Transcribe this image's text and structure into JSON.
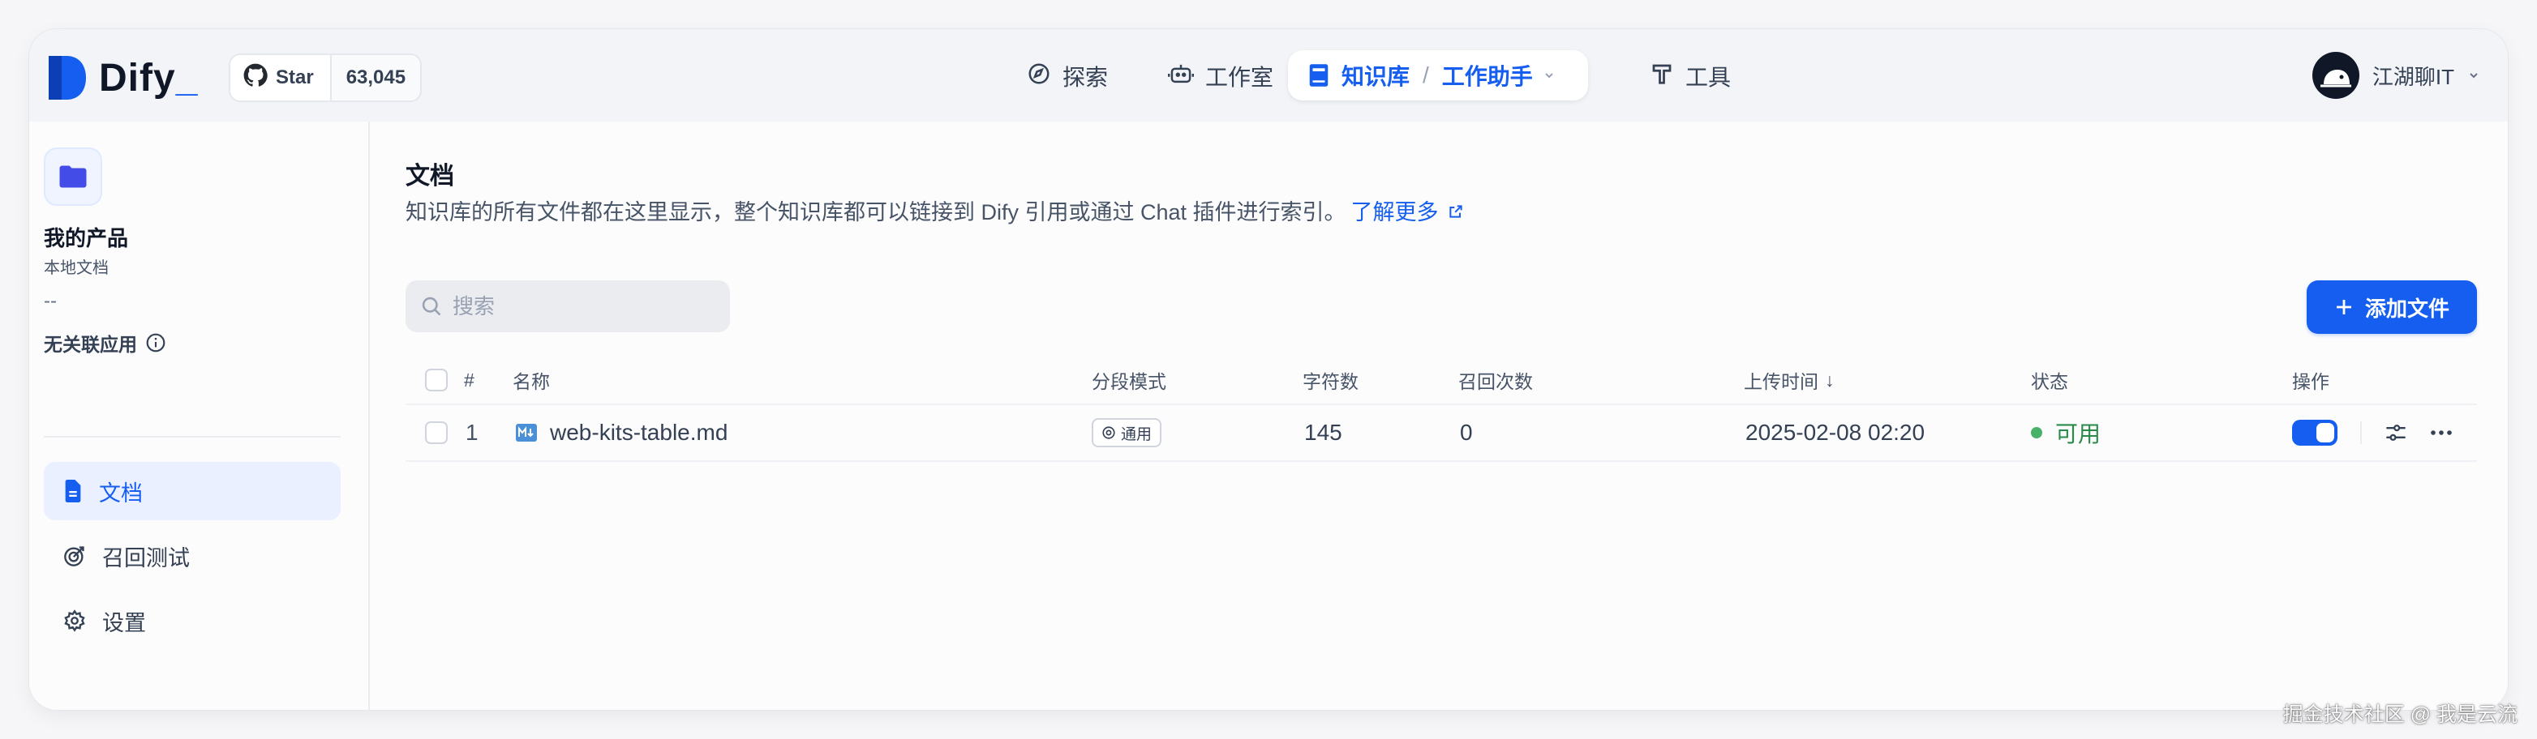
{
  "header": {
    "brand": "Dify",
    "github": {
      "star_label": "Star",
      "star_count": "63,045"
    },
    "nav": [
      {
        "label": "探索",
        "icon": "compass-icon"
      },
      {
        "label": "工作室",
        "icon": "robot-icon"
      },
      {
        "label": "工具",
        "icon": "hammer-icon"
      }
    ],
    "active_nav": {
      "label": "知识库",
      "separator": "/",
      "current": "工作助手",
      "icon": "book-icon"
    },
    "user": {
      "name": "江湖聊IT",
      "icon": "chevron-down-icon"
    }
  },
  "sidebar": {
    "dataset_name": "我的产品",
    "dataset_type": "本地文档",
    "dataset_desc": "--",
    "linked_apps": "无关联应用",
    "items": [
      {
        "label": "文档",
        "icon": "document-icon",
        "active": true
      },
      {
        "label": "召回测试",
        "icon": "target-icon",
        "active": false
      },
      {
        "label": "设置",
        "icon": "gear-icon",
        "active": false
      }
    ]
  },
  "main": {
    "title": "文档",
    "description": "知识库的所有文件都在这里显示，整个知识库都可以链接到 Dify 引用或通过 Chat 插件进行索引。",
    "learn_more": "了解更多",
    "search_placeholder": "搜索",
    "add_button": "添加文件",
    "table": {
      "columns": [
        "#",
        "名称",
        "分段模式",
        "字符数",
        "召回次数",
        "上传时间",
        "状态",
        "操作"
      ],
      "sort_indicator": "↓",
      "rows": [
        {
          "index": "1",
          "name": "web-kits-table.md",
          "mode": "通用",
          "chars": "145",
          "hits": "0",
          "uploaded": "2025-02-08 02:20",
          "status": "可用",
          "enabled": true
        }
      ]
    }
  },
  "colors": {
    "accent": "#155eef",
    "status_ok": "#47b267",
    "brand_dark": "#101828"
  },
  "watermark": "掘金技术社区 @ 我是云流"
}
